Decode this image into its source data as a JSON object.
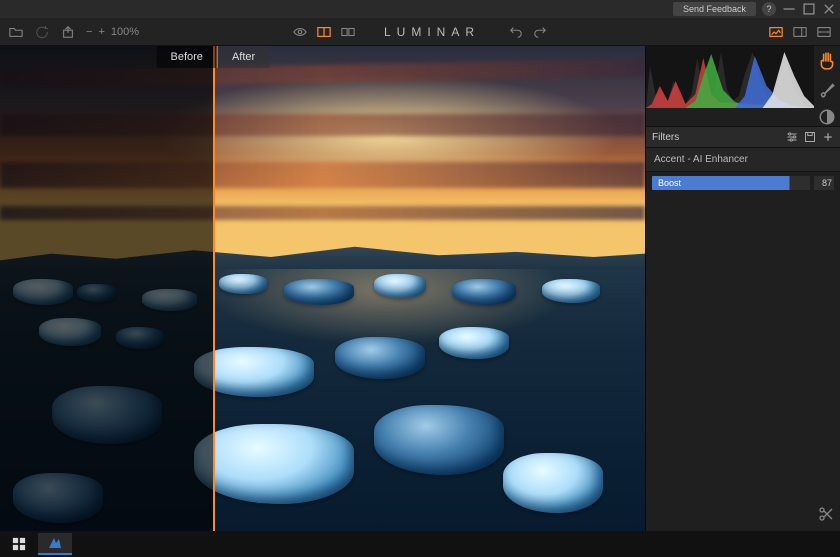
{
  "titlebar": {
    "feedback_label": "Send Feedback",
    "help_label": "?"
  },
  "toolbar": {
    "zoom_value": "100%",
    "app_title": "LUMINAR"
  },
  "compare": {
    "before_label": "Before",
    "after_label": "After",
    "divider_position_pct": 33
  },
  "panel": {
    "filters_header": "Filters",
    "filter_name": "Accent - AI Enhancer",
    "slider_label": "Boost",
    "slider_value": "87"
  }
}
